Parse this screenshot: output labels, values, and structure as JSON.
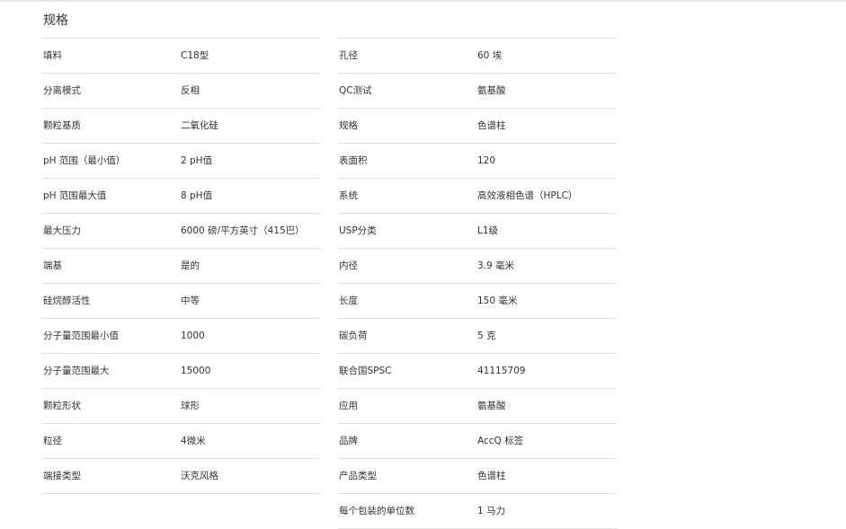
{
  "section_title": "规格",
  "left_rows": [
    {
      "key": "填料",
      "value": "C18型"
    },
    {
      "key": "分离模式",
      "value": "反相"
    },
    {
      "key": "颗粒基质",
      "value": "二氧化硅"
    },
    {
      "key": "pH 范围（最小值）",
      "value": "2 pH值"
    },
    {
      "key": "pH 范围最大值",
      "value": "8 pH值"
    },
    {
      "key": "最大压力",
      "value": "6000 磅/平方英寸（415巴）"
    },
    {
      "key": "端基",
      "value": "是的"
    },
    {
      "key": "硅烷醇活性",
      "value": "中等"
    },
    {
      "key": "分子量范围最小值",
      "value": "1000"
    },
    {
      "key": "分子量范围最大",
      "value": "15000"
    },
    {
      "key": "颗粒形状",
      "value": "球形"
    },
    {
      "key": "粒径",
      "value": "4微米"
    },
    {
      "key": "端接类型",
      "value": "沃克风格"
    }
  ],
  "right_rows": [
    {
      "key": "孔径",
      "value": "60 埃"
    },
    {
      "key": "QC测试",
      "value": "氨基酸"
    },
    {
      "key": "规格",
      "value": "色谱柱"
    },
    {
      "key": "表面积",
      "value": "120"
    },
    {
      "key": "系统",
      "value": "高效液相色谱（HPLC）"
    },
    {
      "key": "USP分类",
      "value": "L1级"
    },
    {
      "key": "内径",
      "value": "3.9 毫米"
    },
    {
      "key": "长度",
      "value": "150 毫米"
    },
    {
      "key": "碳负荷",
      "value": "5 克"
    },
    {
      "key": "联合国SPSC",
      "value": "41115709"
    },
    {
      "key": "应用",
      "value": "氨基酸"
    },
    {
      "key": "品牌",
      "value": "AccQ 标签"
    },
    {
      "key": "产品类型",
      "value": "色谱柱"
    },
    {
      "key": "每个包装的单位数",
      "value": "1 马力"
    }
  ]
}
